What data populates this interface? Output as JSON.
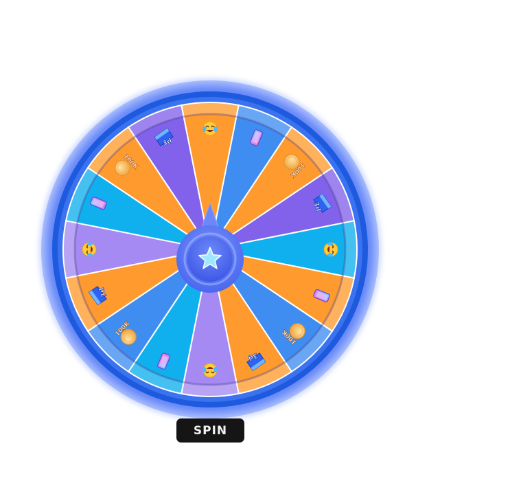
{
  "wheel": {
    "colors": {
      "orange": "#FF9B2E",
      "blue": "#3F8DF0",
      "purple": "#8262EA",
      "cyan": "#10B0EE",
      "lavender": "#A48AF2",
      "rim_outer": "#5B7CF8",
      "rim_inner": "#1F5FDE",
      "hub": "#5D7CF6",
      "star": "#9EE7FF"
    },
    "segments": [
      {
        "color": "orange",
        "prize": "emoji-icon",
        "label": ""
      },
      {
        "color": "blue",
        "prize": "phone-icon",
        "label": ""
      },
      {
        "color": "orange",
        "prize": "coin-icon",
        "label": "100K"
      },
      {
        "color": "purple",
        "prize": "ticket-3d-icon",
        "label": "3d"
      },
      {
        "color": "cyan",
        "prize": "emoji-icon",
        "label": ""
      },
      {
        "color": "orange",
        "prize": "phone-icon",
        "label": ""
      },
      {
        "color": "blue",
        "prize": "coin-icon",
        "label": "100K"
      },
      {
        "color": "orange",
        "prize": "ticket-3d-icon",
        "label": "3d"
      },
      {
        "color": "lavender",
        "prize": "emoji-icon",
        "label": ""
      },
      {
        "color": "cyan",
        "prize": "phone-icon",
        "label": ""
      },
      {
        "color": "blue",
        "prize": "coin-icon",
        "label": "100K"
      },
      {
        "color": "orange",
        "prize": "ticket-3d-icon",
        "label": "3d"
      },
      {
        "color": "lavender",
        "prize": "emoji-icon",
        "label": ""
      },
      {
        "color": "cyan",
        "prize": "phone-icon",
        "label": ""
      },
      {
        "color": "orange",
        "prize": "coin-icon",
        "label": "100K"
      },
      {
        "color": "purple",
        "prize": "ticket-3d-icon",
        "label": "3d"
      }
    ],
    "pointer_icon": "star-icon"
  },
  "spin_button": {
    "label": "SPIN"
  }
}
